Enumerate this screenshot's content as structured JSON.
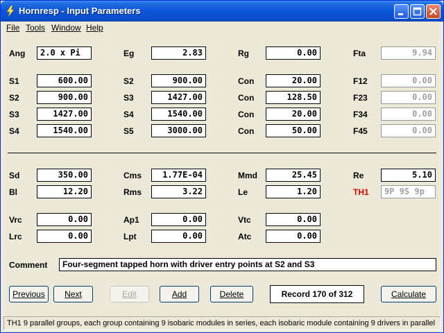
{
  "window": {
    "title": "Hornresp - Input Parameters"
  },
  "menu": [
    "File",
    "Tools",
    "Window",
    "Help"
  ],
  "fields": {
    "Ang": {
      "label": "Ang",
      "value": "2.0 x Pi"
    },
    "Eg": {
      "label": "Eg",
      "value": "2.83"
    },
    "Rg": {
      "label": "Rg",
      "value": "0.00"
    },
    "Fta": {
      "label": "Fta",
      "value": "9.94"
    },
    "S1": {
      "label": "S1",
      "value": "600.00"
    },
    "S2a": {
      "label": "S2",
      "value": "900.00"
    },
    "Con1": {
      "label": "Con",
      "value": "20.00"
    },
    "F12": {
      "label": "F12",
      "value": "0.00"
    },
    "S2b": {
      "label": "S2",
      "value": "900.00"
    },
    "S3a": {
      "label": "S3",
      "value": "1427.00"
    },
    "Con2": {
      "label": "Con",
      "value": "128.50"
    },
    "F23": {
      "label": "F23",
      "value": "0.00"
    },
    "S3b": {
      "label": "S3",
      "value": "1427.00"
    },
    "S4a": {
      "label": "S4",
      "value": "1540.00"
    },
    "Con3": {
      "label": "Con",
      "value": "20.00"
    },
    "F34": {
      "label": "F34",
      "value": "0.00"
    },
    "S4b": {
      "label": "S4",
      "value": "1540.00"
    },
    "S5": {
      "label": "S5",
      "value": "3000.00"
    },
    "Con4": {
      "label": "Con",
      "value": "50.00"
    },
    "F45": {
      "label": "F45",
      "value": "0.00"
    },
    "Sd": {
      "label": "Sd",
      "value": "350.00"
    },
    "Cms": {
      "label": "Cms",
      "value": "1.77E-04"
    },
    "Mmd": {
      "label": "Mmd",
      "value": "25.45"
    },
    "Re": {
      "label": "Re",
      "value": "5.10"
    },
    "Bl": {
      "label": "Bl",
      "value": "12.20"
    },
    "Rms": {
      "label": "Rms",
      "value": "3.22"
    },
    "Le": {
      "label": "Le",
      "value": "1.20"
    },
    "TH1": {
      "label": "TH1",
      "value": "9P 9S 9p"
    },
    "Vrc": {
      "label": "Vrc",
      "value": "0.00"
    },
    "Ap1": {
      "label": "Ap1",
      "value": "0.00"
    },
    "Vtc": {
      "label": "Vtc",
      "value": "0.00"
    },
    "Lrc": {
      "label": "Lrc",
      "value": "0.00"
    },
    "Lpt": {
      "label": "Lpt",
      "value": "0.00"
    },
    "Atc": {
      "label": "Atc",
      "value": "0.00"
    }
  },
  "comment": {
    "label": "Comment",
    "value": "Four-segment tapped horn with driver entry points at S2 and S3"
  },
  "buttons": {
    "previous": "Previous",
    "next": "Next",
    "edit": "Edit",
    "add": "Add",
    "delete": "Delete",
    "calculate": "Calculate"
  },
  "record": "Record 170 of 312",
  "status": "TH1   9 parallel groups, each group containing 9 isobaric modules in series, each isobaric module containing 9 drivers in parallel",
  "colors": {
    "titlebar": "#0A55D8",
    "th1_label": "#E00000",
    "disabled_text": "#A0A0A0",
    "background": "#ECE9D8"
  }
}
